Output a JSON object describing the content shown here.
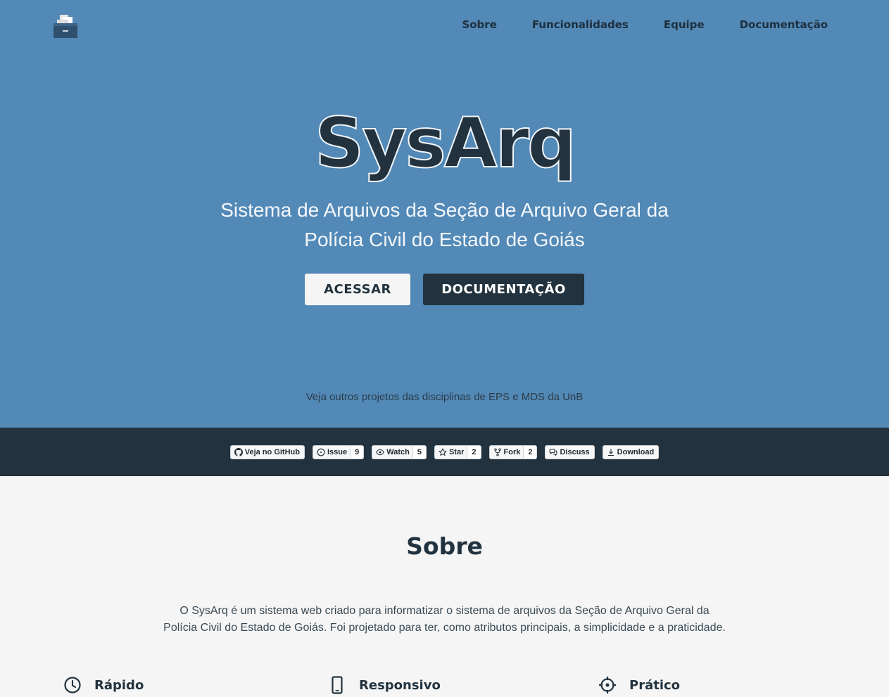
{
  "nav": {
    "items": [
      "Sobre",
      "Funcionalidades",
      "Equipe",
      "Documentação"
    ]
  },
  "hero": {
    "title": "SysArq",
    "subtitle": "Sistema de Arquivos da Seção de Arquivo Geral da Polícia Civil do Estado de Goiás",
    "btn_access": "ACESSAR",
    "btn_docs": "DOCUMENTAÇÃO",
    "projects_link": "Veja outros projetos das disciplinas de EPS e MDS da UnB"
  },
  "badges": {
    "github": "Veja no GitHub",
    "issue": "Issue",
    "issue_count": "9",
    "watch": "Watch",
    "watch_count": "5",
    "star": "Star",
    "star_count": "2",
    "fork": "Fork",
    "fork_count": "2",
    "discuss": "Discuss",
    "download": "Download"
  },
  "about": {
    "title": "Sobre",
    "text": "O SysArq é um sistema web criado para informatizar o sistema de arquivos da Seção de Arquivo Geral da Polícia Civil do Estado de Goiás. Foi projetado para ter, como atributos principais, a simplicidade e a praticidade.",
    "features": [
      {
        "label": "Rápido",
        "icon": "clock-icon"
      },
      {
        "label": "Responsivo",
        "icon": "mobile-icon"
      },
      {
        "label": "Prático",
        "icon": "crosshair-icon"
      }
    ]
  },
  "colors": {
    "hero_bg": "#5289b7",
    "dark": "#22333f",
    "light_bg": "#f5f5f5"
  }
}
